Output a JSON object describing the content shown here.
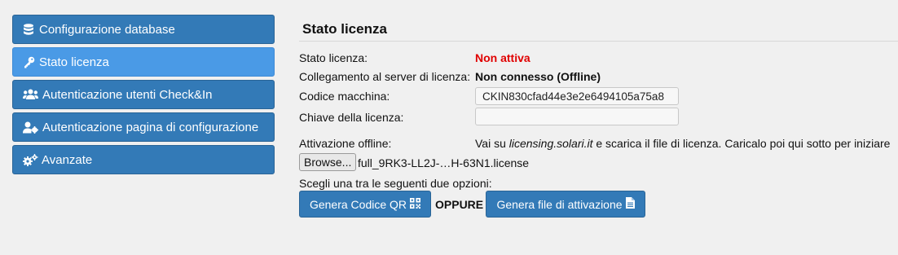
{
  "sidebar": {
    "items": [
      {
        "label": "Configurazione database",
        "icon": "database-icon"
      },
      {
        "label": "Stato licenza",
        "icon": "key-icon",
        "active": true
      },
      {
        "label": "Autenticazione utenti Check&In",
        "icon": "users-icon"
      },
      {
        "label": "Autenticazione pagina di configurazione",
        "icon": "user-gear-icon"
      },
      {
        "label": "Avanzate",
        "icon": "cogs-icon"
      }
    ]
  },
  "main": {
    "title": "Stato licenza",
    "status_label": "Stato licenza:",
    "status_value": "Non attiva",
    "server_label": "Collegamento al server di licenza:",
    "server_value": "Non connesso (Offline)",
    "machine_label": "Codice macchina:",
    "machine_value": "CKIN830cfad44e3e2e6494105a75a8",
    "key_label": "Chiave della licenza:",
    "key_value": "",
    "offline_label": "Attivazione offline:",
    "offline_text_before": "Vai su ",
    "offline_link": "licensing.solari.it",
    "offline_text_after": " e scarica il file di licenza. Caricalo poi qui sotto per iniziare",
    "browse_label": "Browse...",
    "file_name": "full_9RK3-LL2J-…H-63N1.license",
    "choose_text": "Scegli una tra le seguenti due opzioni:",
    "qr_button": "Genera Codice QR",
    "or_text": "OPPURE",
    "file_button": "Genera file di attivazione"
  },
  "colors": {
    "primary": "#337ab7",
    "active": "#4a9ae6",
    "danger": "#e00000"
  }
}
